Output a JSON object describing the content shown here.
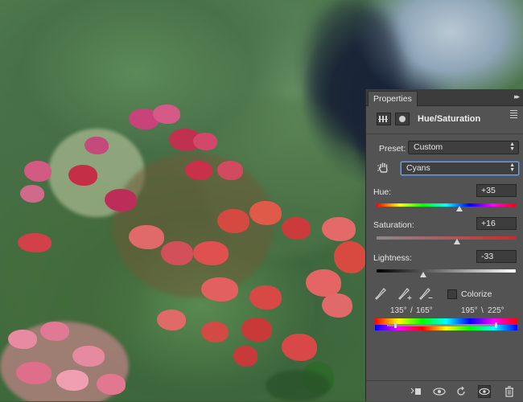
{
  "panel": {
    "tab_label": "Properties",
    "collapse_glyph": "▸▸",
    "adjustment_title": "Hue/Saturation",
    "preset": {
      "label": "Preset:",
      "value": "Custom"
    },
    "channel": {
      "value": "Cyans"
    },
    "hue": {
      "label": "Hue:",
      "value": "+35",
      "level": 0.597
    },
    "saturation": {
      "label": "Saturation:",
      "value": "+16",
      "level": 0.58
    },
    "lightness": {
      "label": "Lightness:",
      "value": "-33",
      "level": 0.335
    },
    "colorize": {
      "label": "Colorize",
      "checked": false
    },
    "range": {
      "a": "135°",
      "sep1": "/",
      "b": "165°",
      "c": "195°",
      "sep2": "\\",
      "d": "225°"
    },
    "icons": {
      "adjustment_icon": "hue-saturation-icon",
      "mask_icon": "mask-icon",
      "hand_tool": "targeted-adjustment-hand-icon",
      "eyedropper": "eyedropper-icon",
      "eyedropper_plus": "eyedropper-plus-icon",
      "eyedropper_minus": "eyedropper-minus-icon",
      "clip": "clip-to-layer-icon",
      "view_previous": "view-previous-icon",
      "reset": "reset-icon",
      "visibility": "eye-icon",
      "delete": "trash-icon"
    }
  }
}
